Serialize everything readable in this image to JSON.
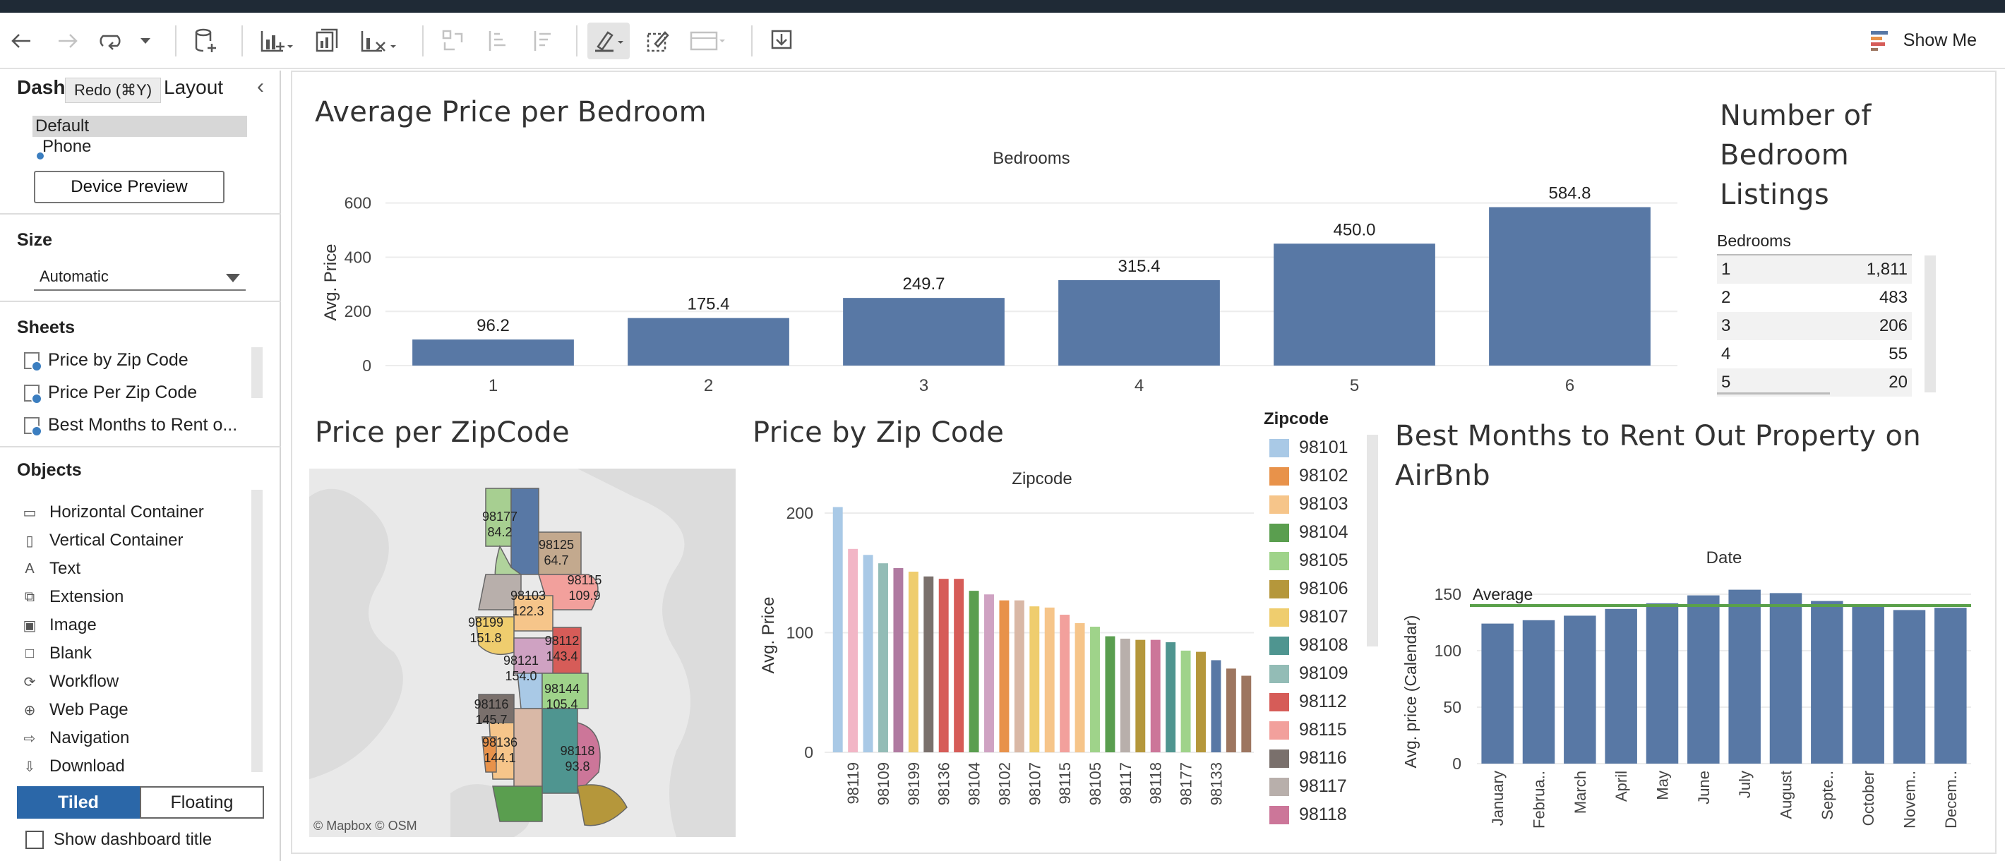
{
  "toolbar": {
    "show_me_label": "Show Me"
  },
  "left_pane": {
    "tab_dashboard": "Dashb",
    "tooltip": "Redo  (⌘Y)",
    "tab_layout": "Layout",
    "device_default": "Default",
    "device_phone": "Phone",
    "device_preview_label": "Device Preview",
    "size_title": "Size",
    "size_value": "Automatic",
    "sheets_title": "Sheets",
    "sheets": [
      "Price by Zip Code",
      "Price Per Zip Code",
      "Best Months to Rent o..."
    ],
    "objects_title": "Objects",
    "objects": [
      "Horizontal Container",
      "Vertical Container",
      "Text",
      "Extension",
      "Image",
      "Blank",
      "Workflow",
      "Web Page",
      "Navigation",
      "Download"
    ],
    "tiled_label": "Tiled",
    "floating_label": "Floating",
    "show_title_label": "Show dashboard title"
  },
  "dashboard": {
    "bedroom_title": "Average Price per Bedroom",
    "listings_title": "Number of Bedroom Listings",
    "zipmap_title": "Price per ZipCode",
    "zipbar_title": "Price by Zip Code",
    "months_title": "Best Months to Rent Out Property on AirBnb",
    "map_attribution": "© Mapbox  © OSM",
    "listings_table": {
      "header": "Bedrooms",
      "rows": [
        {
          "bedrooms": "1",
          "count": "1,811"
        },
        {
          "bedrooms": "2",
          "count": "483"
        },
        {
          "bedrooms": "3",
          "count": "206"
        },
        {
          "bedrooms": "4",
          "count": "55"
        },
        {
          "bedrooms": "5",
          "count": "20"
        }
      ]
    },
    "map_labels": [
      {
        "zip": "98177",
        "value": "84.2"
      },
      {
        "zip": "98125",
        "value": "64.7"
      },
      {
        "zip": "98115",
        "value": "109.9"
      },
      {
        "zip": "98103",
        "value": "122.3"
      },
      {
        "zip": "98199",
        "value": "151.8"
      },
      {
        "zip": "98112",
        "value": "143.4"
      },
      {
        "zip": "98121",
        "value": "154.0"
      },
      {
        "zip": "98144",
        "value": "105.4"
      },
      {
        "zip": "98116",
        "value": "145.7"
      },
      {
        "zip": "98136",
        "value": "144.1"
      },
      {
        "zip": "98118",
        "value": "93.8"
      }
    ],
    "zip_legend": {
      "title": "Zipcode",
      "items": [
        {
          "zip": "98101",
          "color": "#a9c9e6"
        },
        {
          "zip": "98102",
          "color": "#e8924a"
        },
        {
          "zip": "98103",
          "color": "#f6c58a"
        },
        {
          "zip": "98104",
          "color": "#5a9e4f"
        },
        {
          "zip": "98105",
          "color": "#9fd38a"
        },
        {
          "zip": "98106",
          "color": "#b5973b"
        },
        {
          "zip": "98107",
          "color": "#efcd6e"
        },
        {
          "zip": "98108",
          "color": "#4f9590"
        },
        {
          "zip": "98109",
          "color": "#93bcb6"
        },
        {
          "zip": "98112",
          "color": "#d65c58"
        },
        {
          "zip": "98115",
          "color": "#f2a09c"
        },
        {
          "zip": "98116",
          "color": "#7a706c"
        },
        {
          "zip": "98117",
          "color": "#b8afab"
        },
        {
          "zip": "98118",
          "color": "#cc7699"
        }
      ]
    }
  },
  "chart_data": [
    {
      "type": "bar",
      "title": "Average Price per Bedroom",
      "subtitle": "Bedrooms",
      "ylabel": "Avg. Price",
      "categories": [
        "1",
        "2",
        "3",
        "4",
        "5",
        "6"
      ],
      "values": [
        96.2,
        175.4,
        249.7,
        315.4,
        450.0,
        584.8
      ],
      "value_labels": [
        "96.2",
        "175.4",
        "249.7",
        "315.4",
        "450.0",
        "584.8"
      ],
      "yticks": [
        "0",
        "200",
        "400",
        "600"
      ],
      "ylim": [
        0,
        620
      ],
      "grid": true,
      "color": "#5878a5"
    },
    {
      "type": "bar",
      "title": "Price by Zip Code",
      "subtitle": "Zipcode",
      "ylabel": "Avg. Price",
      "categories": [
        "98101",
        "98119",
        "98109",
        "98199",
        "98136",
        "98104",
        "98102",
        "98107",
        "98115",
        "98105",
        "98117",
        "98118",
        "98177",
        "98133"
      ],
      "values": [
        205,
        170,
        165,
        158,
        154,
        151,
        147,
        145,
        145,
        135,
        132,
        127,
        127,
        122,
        121,
        115,
        108,
        105,
        97,
        95,
        94,
        94,
        92,
        85,
        84,
        77,
        70,
        64
      ],
      "xtick_labels": [
        "98119",
        "98109",
        "98199",
        "98136",
        "98104",
        "98102",
        "98107",
        "98115",
        "98105",
        "98117",
        "98118",
        "98177",
        "98133"
      ],
      "bar_colors": [
        "#a9c9e6",
        "#f2b6c6",
        "#a9c9e6",
        "#93bcb6",
        "#b07aa1",
        "#efcd6e",
        "#7a706c",
        "#d65c58",
        "#d65c58",
        "#5a9e4f",
        "#cfa2c2",
        "#e8924a",
        "#d9b8a6",
        "#efcd6e",
        "#f6c58a",
        "#f2a09c",
        "#f6c58a",
        "#9fd38a",
        "#5a9e4f",
        "#b8afab",
        "#b5973b",
        "#cc7699",
        "#4f9590",
        "#9fd38a",
        "#b5973b",
        "#5878a5",
        "#9d7660",
        "#9d7660"
      ],
      "yticks": [
        "0",
        "100",
        "200"
      ],
      "ylim": [
        0,
        210
      ],
      "grid": true
    },
    {
      "type": "bar",
      "title": "Best Months to Rent Out Property on AirBnb",
      "subtitle": "Date",
      "ylabel": "Avg. price (Calendar)",
      "categories": [
        "January",
        "Februa..",
        "March",
        "April",
        "May",
        "June",
        "July",
        "August",
        "Septe..",
        "October",
        "Novem..",
        "Decem.."
      ],
      "values": [
        124,
        127,
        131,
        137,
        142,
        149,
        154,
        151,
        144,
        139,
        136,
        138
      ],
      "yticks": [
        "0",
        "50",
        "100",
        "150"
      ],
      "ylim": [
        0,
        160
      ],
      "reference_line": {
        "label": "Average",
        "value": 140,
        "color": "#5aa04a"
      },
      "grid": true,
      "color": "#5878a5"
    }
  ]
}
